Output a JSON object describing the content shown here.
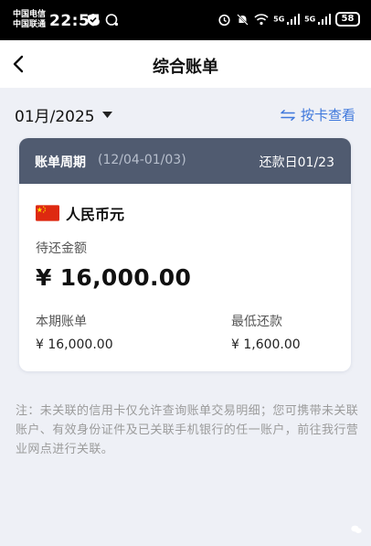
{
  "status_bar": {
    "carrier_1": "中国电信",
    "carrier_2": "中国联通",
    "time": "22:55",
    "signal_1_label": "5G",
    "signal_2_label": "5G",
    "battery": "58"
  },
  "nav": {
    "title": "综合账单"
  },
  "month_selector": {
    "value": "01月/2025"
  },
  "by_card": {
    "label": "按卡查看"
  },
  "bill_card": {
    "period_label": "账单周期",
    "period_range": "(12/04-01/03)",
    "due_date": "还款日01/23",
    "currency": "人民币元",
    "pending_label": "待还金额",
    "pending_amount": "¥ 16,000.00",
    "statement_label": "本期账单",
    "statement_amount": "¥ 16,000.00",
    "min_payment_label": "最低还款",
    "min_payment_amount": "¥ 1,600.00"
  },
  "note": "注：未关联的信用卡仅允许查询账单交易明细；您可携带未关联账户、有效身份证件及已关联手机银行的任一账户，前往我行营业网点进行关联。",
  "colors": {
    "page_bg": "#eef0f6",
    "card_header_bg": "#505b70",
    "link_blue": "#3f78dc"
  },
  "icons": {
    "back": "chevron-left-icon",
    "dropdown": "caret-down-icon",
    "switch": "swap-arrows-icon",
    "flag": "china-flag-icon"
  }
}
